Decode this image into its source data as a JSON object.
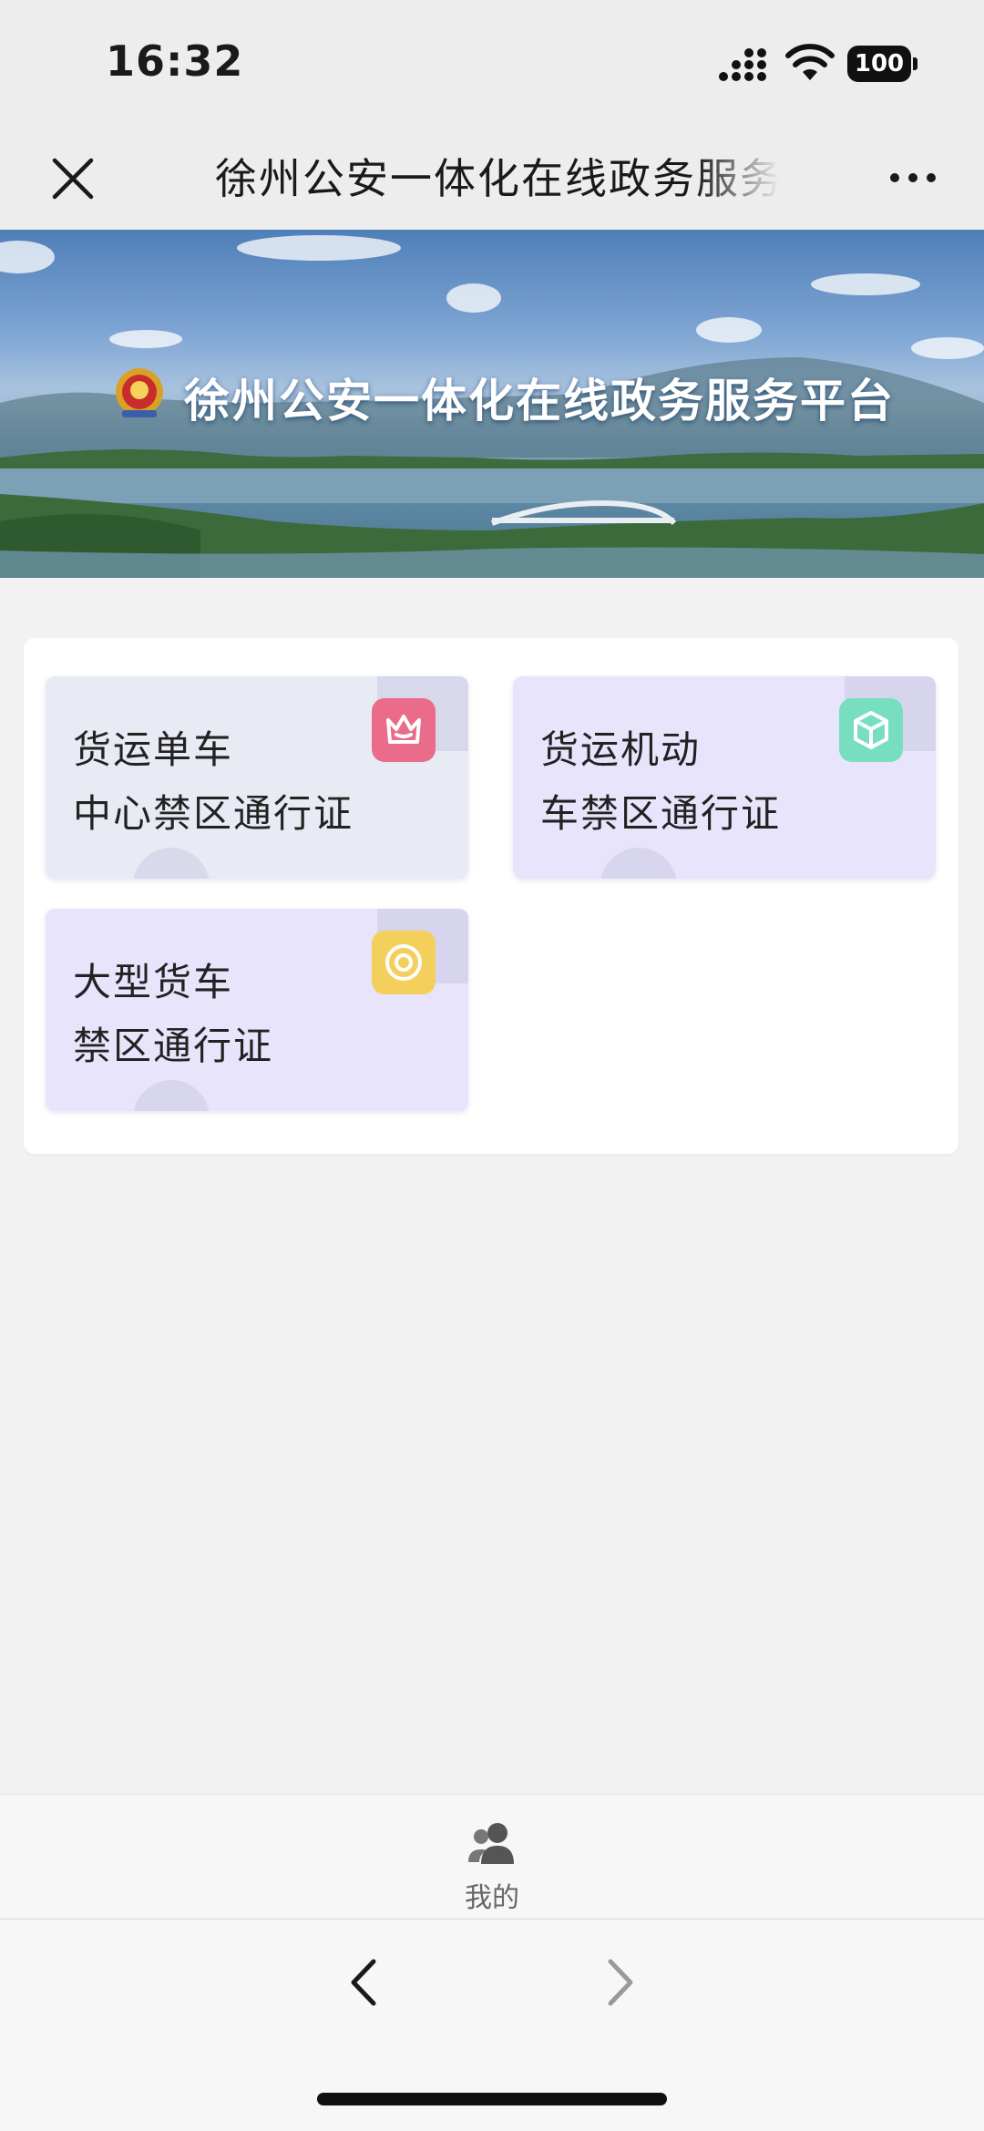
{
  "status_bar": {
    "time": "16:32",
    "battery": "100",
    "icons": [
      "signal-icon",
      "wifi-icon",
      "battery-icon"
    ]
  },
  "nav": {
    "title": "徐州公安一体化在线政务服务平台",
    "close_icon": "close-icon",
    "more_icon": "more-dots-icon"
  },
  "banner": {
    "title": "徐州公安一体化在线政务服务平台",
    "emblem": "police-emblem-icon"
  },
  "services": [
    {
      "label": "货运单车\n中心禁区通行证",
      "icon": "crown-icon",
      "icon_color": "#eb6b8a",
      "bg": "#e8ebf3"
    },
    {
      "label": "货运机动\n车禁区通行证",
      "icon": "cube-icon",
      "icon_color": "#77dfbf",
      "bg": "#e8e4fb"
    },
    {
      "label": "大型货车\n禁区通行证",
      "icon": "target-icon",
      "icon_color": "#f4cf5c",
      "bg": "#e8e4fb"
    }
  ],
  "tab_bar": {
    "items": [
      {
        "label": "我的",
        "icon": "user-icon"
      }
    ]
  },
  "toolbar": {
    "back_icon": "chevron-left-icon",
    "forward_icon": "chevron-right-icon"
  }
}
